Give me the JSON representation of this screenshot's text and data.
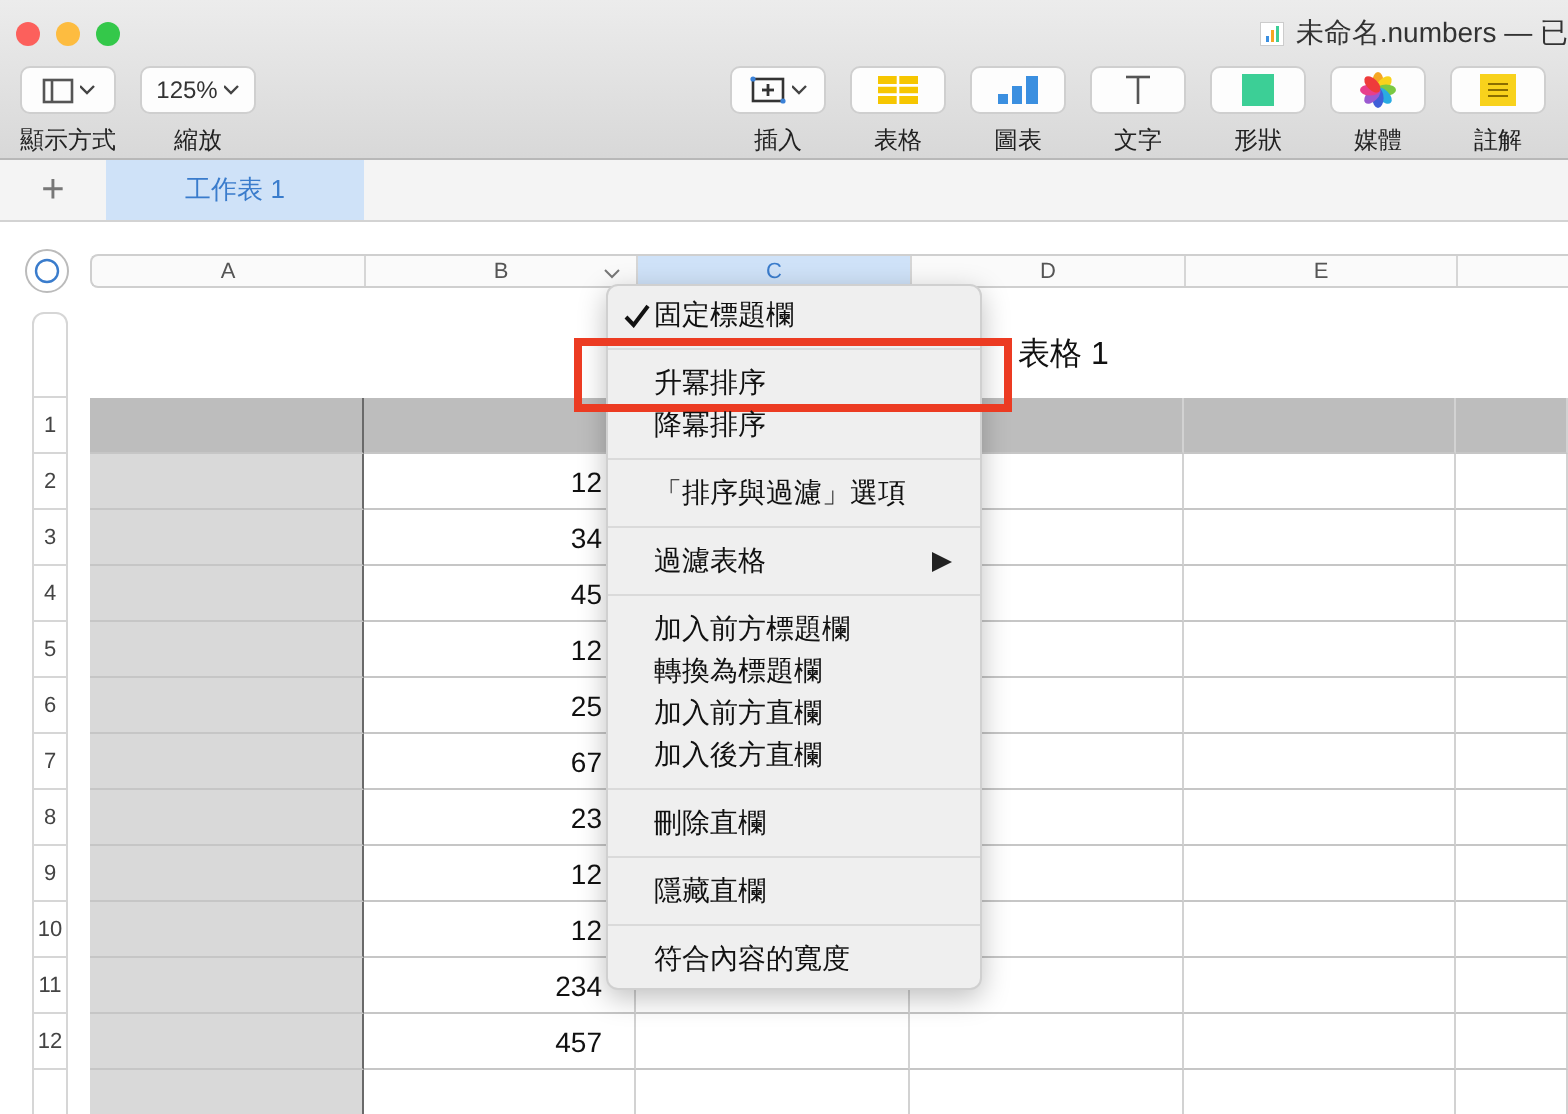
{
  "window": {
    "title": "未命名.numbers — 已"
  },
  "toolbar": {
    "items": [
      {
        "kind": "view",
        "label": "顯示方式"
      },
      {
        "kind": "zoom",
        "label": "縮放",
        "value": "125%"
      },
      {
        "kind": "insert",
        "label": "插入"
      },
      {
        "kind": "table",
        "label": "表格"
      },
      {
        "kind": "chart",
        "label": "圖表"
      },
      {
        "kind": "text",
        "label": "文字"
      },
      {
        "kind": "shape",
        "label": "形狀"
      },
      {
        "kind": "media",
        "label": "媒體"
      },
      {
        "kind": "comment",
        "label": "註解"
      }
    ]
  },
  "sheet_tabs": {
    "add_button": "+",
    "tabs": [
      {
        "label": "工作表 1",
        "selected": true
      }
    ]
  },
  "table": {
    "title": "表格 1",
    "columns": [
      {
        "label": "A",
        "selected": false,
        "menu": false
      },
      {
        "label": "B",
        "selected": false,
        "menu": true
      },
      {
        "label": "C",
        "selected": true,
        "menu": false
      },
      {
        "label": "D",
        "selected": false,
        "menu": false
      },
      {
        "label": "E",
        "selected": false,
        "menu": false
      }
    ],
    "rows": [
      {
        "number": "1",
        "header": true
      },
      {
        "number": "2",
        "header": false,
        "b": "12"
      },
      {
        "number": "3",
        "header": false,
        "b": "34"
      },
      {
        "number": "4",
        "header": false,
        "b": "45"
      },
      {
        "number": "5",
        "header": false,
        "b": "12"
      },
      {
        "number": "6",
        "header": false,
        "b": "25"
      },
      {
        "number": "7",
        "header": false,
        "b": "67"
      },
      {
        "number": "8",
        "header": false,
        "b": "23"
      },
      {
        "number": "9",
        "header": false,
        "b": "12"
      },
      {
        "number": "10",
        "header": false,
        "b": "12"
      },
      {
        "number": "11",
        "header": false,
        "b": "234"
      },
      {
        "number": "12",
        "header": false,
        "b": "457"
      }
    ]
  },
  "context_menu": {
    "groups": [
      [
        {
          "label": "固定標題欄",
          "checked": true,
          "highlighted": false,
          "submenu": false
        }
      ],
      [
        {
          "label": "升冪排序",
          "checked": false,
          "highlighted": true,
          "submenu": false
        },
        {
          "label": "降冪排序",
          "checked": false,
          "highlighted": false,
          "submenu": false
        }
      ],
      [
        {
          "label": "「排序與過濾」選項",
          "checked": false,
          "highlighted": false,
          "submenu": false
        }
      ],
      [
        {
          "label": "過濾表格",
          "checked": false,
          "highlighted": false,
          "submenu": true
        }
      ],
      [
        {
          "label": "加入前方標題欄",
          "checked": false,
          "highlighted": false,
          "submenu": false
        },
        {
          "label": "轉換為標題欄",
          "checked": false,
          "highlighted": false,
          "submenu": false
        },
        {
          "label": "加入前方直欄",
          "checked": false,
          "highlighted": false,
          "submenu": false
        },
        {
          "label": "加入後方直欄",
          "checked": false,
          "highlighted": false,
          "submenu": false
        }
      ],
      [
        {
          "label": "刪除直欄",
          "checked": false,
          "highlighted": false,
          "submenu": false
        }
      ],
      [
        {
          "label": "隱藏直欄",
          "checked": false,
          "highlighted": false,
          "submenu": false
        }
      ],
      [
        {
          "label": "符合內容的寬度",
          "checked": false,
          "highlighted": false,
          "submenu": false
        }
      ]
    ]
  }
}
